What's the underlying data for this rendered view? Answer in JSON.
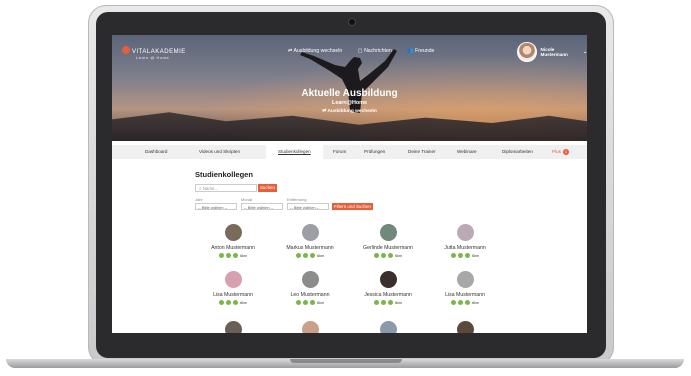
{
  "header": {
    "logo_text": "VITALAKADEMIE",
    "logo_sub": "Learn @ Home",
    "nav": [
      "Ausbildung wechseln",
      "Nachrichten",
      "Freunde"
    ],
    "user_name": "Nicole Mustermann"
  },
  "hero": {
    "title": "Aktuelle Ausbildung",
    "subtitle": "Learn@Home",
    "switch_label": "Ausbildung wechseln"
  },
  "tabs": [
    "Dashboard",
    "Videos und Skripten",
    "Studienkollegen",
    "Forum",
    "Prüfungen",
    "Deine Trainer",
    "Webinare",
    "Diplomarbeiten",
    "Plus"
  ],
  "tab_active_index": 2,
  "plus_badge": "1",
  "page": {
    "title": "Studienkollegen",
    "search_placeholder": "Name...",
    "search_button": "Suchen",
    "filters": [
      {
        "label": "Jahr",
        "value": "-- Bitte wählen --"
      },
      {
        "label": "Monat",
        "value": "-- Bitte wählen --"
      },
      {
        "label": "Entfernung",
        "value": "-- Bitte wählen --"
      }
    ],
    "filter_button": "Filtern und Suchen"
  },
  "students": [
    {
      "name": "Anton Mustermann",
      "distance": "6km"
    },
    {
      "name": "Markus Mustermann",
      "distance": "6km"
    },
    {
      "name": "Gerlinde Mustermann",
      "distance": "6km"
    },
    {
      "name": "Jutta Mustermann",
      "distance": "6km"
    },
    {
      "name": "Lisa Mustermann",
      "distance": "6km"
    },
    {
      "name": "Leo Mustermann",
      "distance": "6km"
    },
    {
      "name": "Jessica Mustermann",
      "distance": "6km"
    },
    {
      "name": "Lisa Mustermann",
      "distance": "6km"
    }
  ],
  "colors": {
    "accent": "#e4603b",
    "icon_green": "#7ab648"
  }
}
